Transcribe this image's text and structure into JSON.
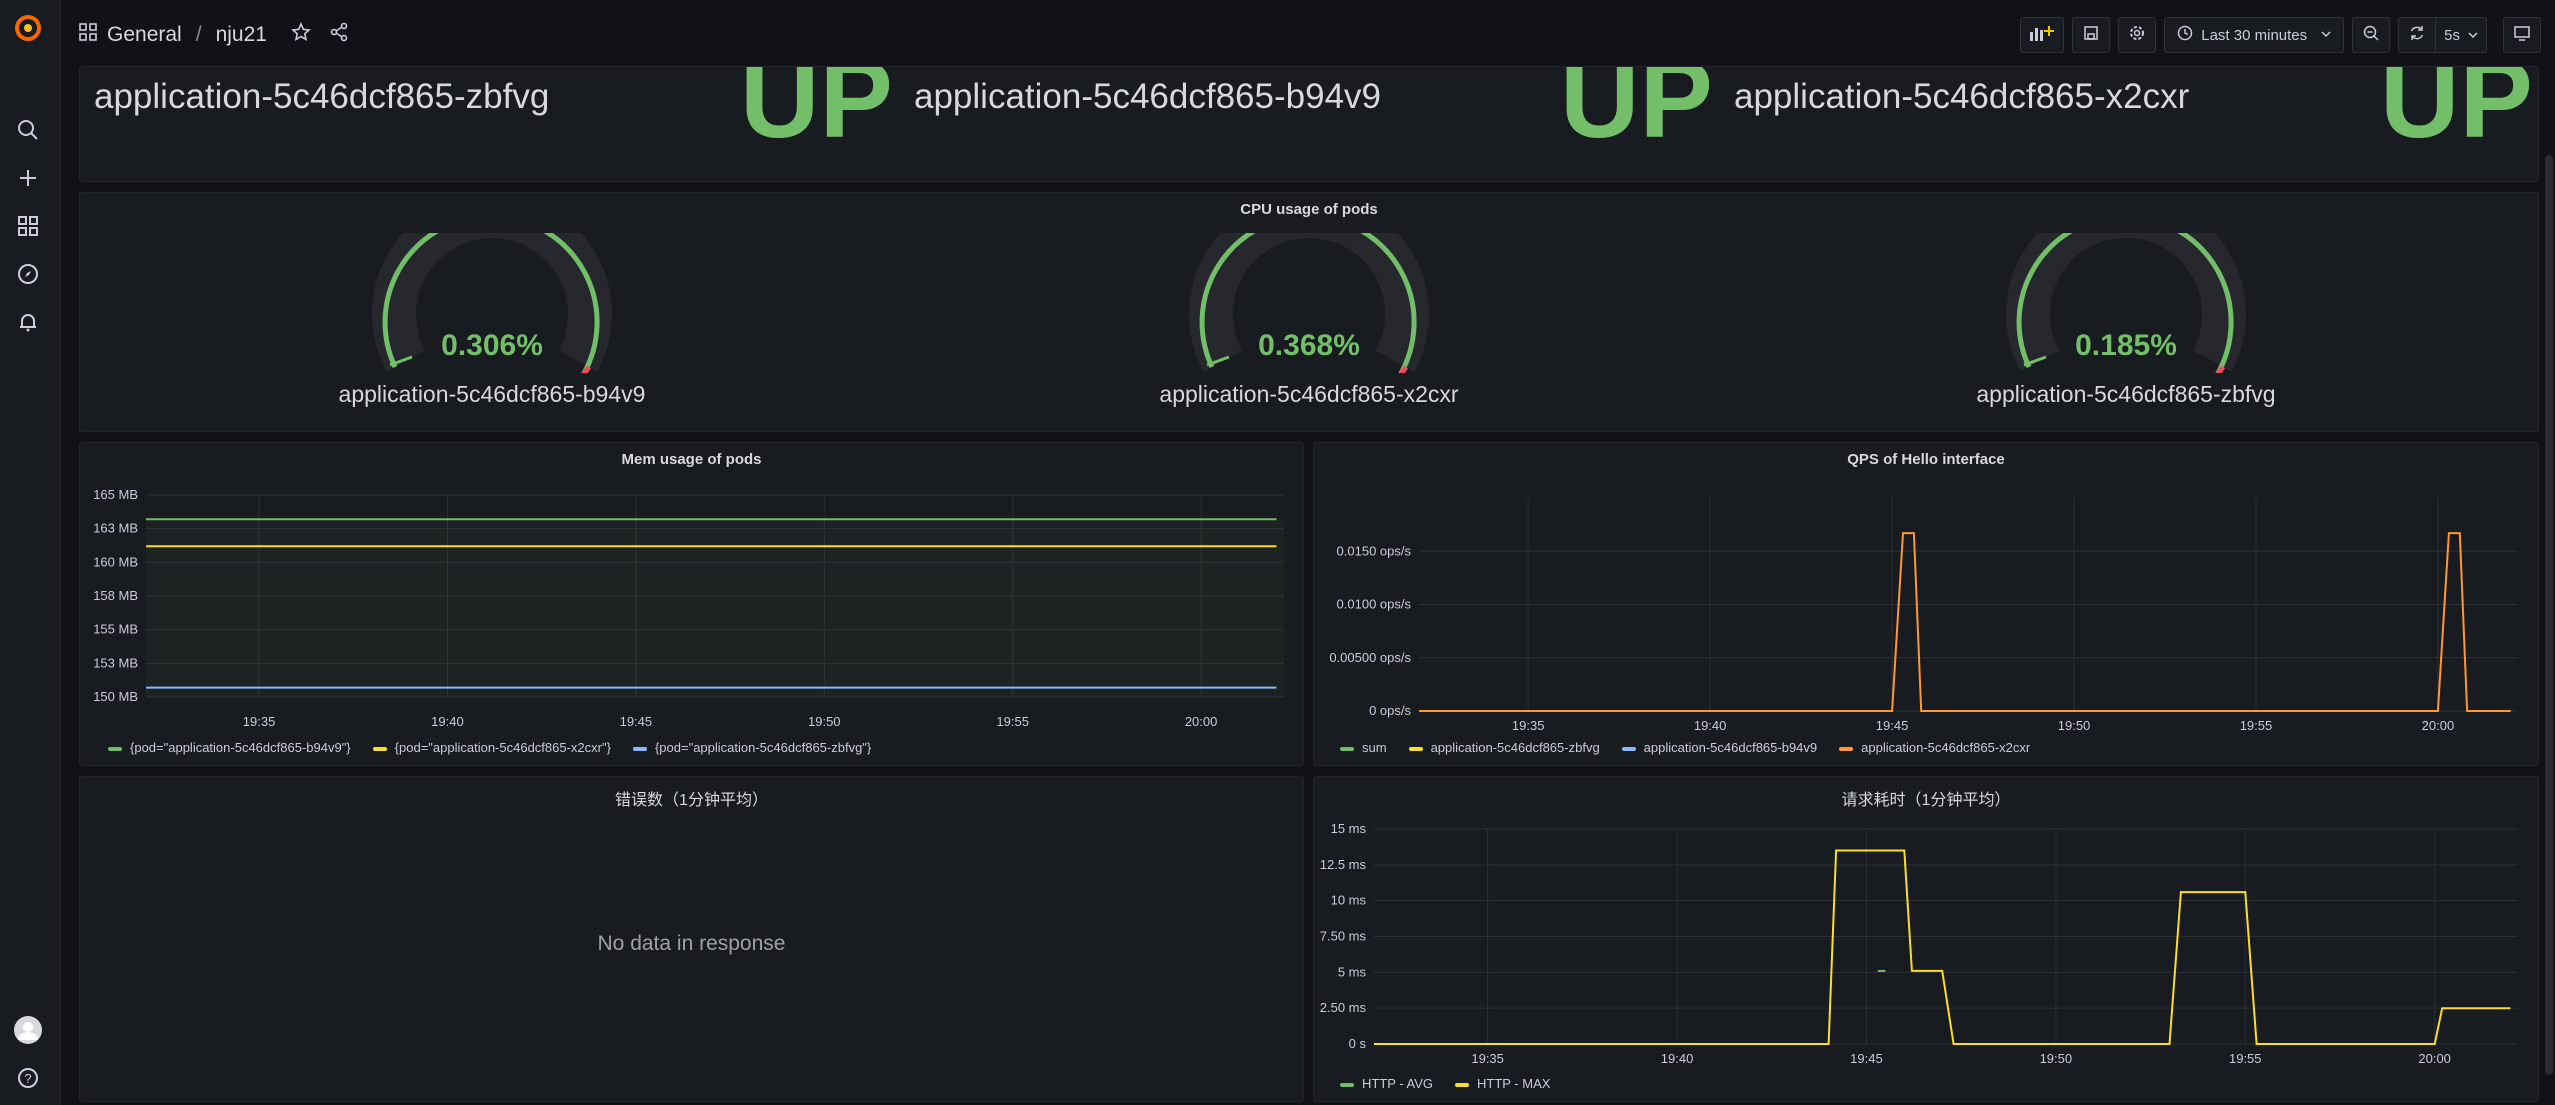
{
  "topbar": {
    "folder": "General",
    "separator": "/",
    "dashboard": "nju21",
    "time_range": "Last 30 minutes",
    "refresh": "5s"
  },
  "status_panels": [
    {
      "name": "application-5c46dcf865-zbfvg",
      "value": "UP"
    },
    {
      "name": "application-5c46dcf865-b94v9",
      "value": "UP"
    },
    {
      "name": "application-5c46dcf865-x2cxr",
      "value": "UP"
    }
  ],
  "cpu_panel": {
    "title": "CPU usage of pods",
    "gauges": [
      {
        "value": "0.306%",
        "name": "application-5c46dcf865-b94v9"
      },
      {
        "value": "0.368%",
        "name": "application-5c46dcf865-x2cxr"
      },
      {
        "value": "0.185%",
        "name": "application-5c46dcf865-zbfvg"
      }
    ]
  },
  "mem_panel": {
    "title": "Mem usage of pods",
    "legend": [
      {
        "label": "{pod=\"application-5c46dcf865-b94v9\"}",
        "color": "#73bf69"
      },
      {
        "label": "{pod=\"application-5c46dcf865-x2cxr\"}",
        "color": "#fade2a"
      },
      {
        "label": "{pod=\"application-5c46dcf865-zbfvg\"}",
        "color": "#8ab8ff"
      }
    ]
  },
  "qps_panel": {
    "title": "QPS of Hello interface",
    "legend": [
      {
        "label": "sum",
        "color": "#73bf69"
      },
      {
        "label": "application-5c46dcf865-zbfvg",
        "color": "#fade2a"
      },
      {
        "label": "application-5c46dcf865-b94v9",
        "color": "#8ab8ff"
      },
      {
        "label": "application-5c46dcf865-x2cxr",
        "color": "#ff9830"
      }
    ]
  },
  "err_panel": {
    "title": "错误数（1分钟平均）",
    "message": "No data in response"
  },
  "latency_panel": {
    "title": "请求耗时（1分钟平均）",
    "legend": [
      {
        "label": "HTTP - AVG",
        "color": "#73bf69"
      },
      {
        "label": "HTTP - MAX",
        "color": "#fade2a"
      }
    ]
  },
  "chart_data": [
    {
      "type": "line",
      "title": "Mem usage of pods",
      "x_ticks": [
        "19:35",
        "19:40",
        "19:45",
        "19:50",
        "19:55",
        "20:00"
      ],
      "y_ticks": [
        "150 MB",
        "153 MB",
        "155 MB",
        "158 MB",
        "160 MB",
        "163 MB",
        "165 MB"
      ],
      "ylim": [
        150,
        165
      ],
      "series": [
        {
          "name": "{pod=\"application-5c46dcf865-b94v9\"}",
          "x": [
            "19:32",
            "19:40",
            "20:00",
            "20:02"
          ],
          "values": [
            163.2,
            163.2,
            163.2,
            163.2
          ]
        },
        {
          "name": "{pod=\"application-5c46dcf865-x2cxr\"}",
          "x": [
            "19:32",
            "19:40",
            "20:00",
            "20:02"
          ],
          "values": [
            161.2,
            161.2,
            161.2,
            161.2
          ]
        },
        {
          "name": "{pod=\"application-5c46dcf865-zbfvg\"}",
          "x": [
            "19:32",
            "19:40",
            "20:00",
            "20:02"
          ],
          "values": [
            150.7,
            150.7,
            150.7,
            150.7
          ]
        }
      ]
    },
    {
      "type": "line",
      "title": "QPS of Hello interface",
      "x_ticks": [
        "19:35",
        "19:40",
        "19:45",
        "19:50",
        "19:55",
        "20:00"
      ],
      "y_ticks": [
        "0 ops/s",
        "0.00500 ops/s",
        "0.0100 ops/s",
        "0.0150 ops/s"
      ],
      "ylim": [
        0,
        0.02
      ],
      "series": [
        {
          "name": "application-5c46dcf865-x2cxr",
          "x": [
            "19:32",
            "19:45",
            "19:45.3",
            "19:45.6",
            "19:45.8",
            "20:00",
            "20:00.3",
            "20:00.6",
            "20:00.8",
            "20:02"
          ],
          "values": [
            0,
            0,
            0.0167,
            0.0167,
            0,
            0,
            0.0167,
            0.0167,
            0,
            0
          ]
        }
      ]
    },
    {
      "type": "line",
      "title": "请求耗时（1分钟平均）",
      "x_ticks": [
        "19:35",
        "19:40",
        "19:45",
        "19:50",
        "19:55",
        "20:00"
      ],
      "y_ticks": [
        "0 s",
        "2.50 ms",
        "5 ms",
        "7.50 ms",
        "10 ms",
        "12.5 ms",
        "15 ms"
      ],
      "ylim": [
        0,
        15
      ],
      "series": [
        {
          "name": "HTTP - MAX",
          "x": [
            "19:32",
            "19:44",
            "19:44.2",
            "19:46",
            "19:46.2",
            "19:47",
            "19:47.3",
            "19:53",
            "19:53.3",
            "19:55",
            "19:55.3",
            "20:00",
            "20:00.2",
            "20:02"
          ],
          "values": [
            0,
            0,
            13.5,
            13.5,
            5.1,
            5.1,
            0,
            0,
            10.6,
            10.6,
            0,
            0,
            2.5,
            2.5
          ]
        },
        {
          "name": "HTTP - AVG",
          "x": [
            "19:45.3",
            "19:45.5"
          ],
          "values": [
            5.1,
            5.1
          ]
        }
      ]
    }
  ]
}
